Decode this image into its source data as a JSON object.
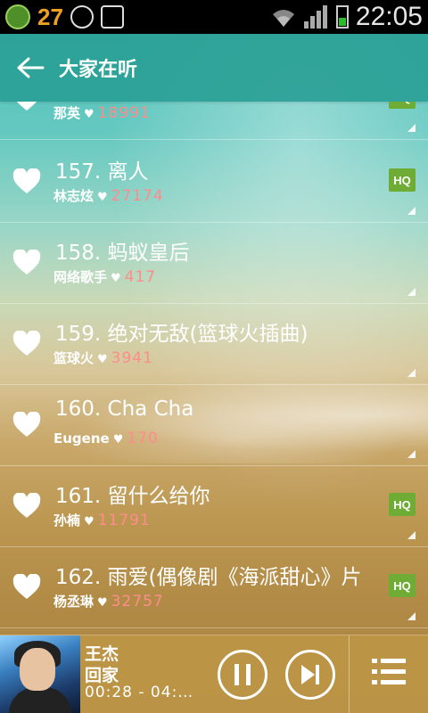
{
  "status_bar": {
    "notification_count": "27",
    "time": "22:05"
  },
  "header": {
    "title": "大家在听"
  },
  "songs": [
    {
      "title": "",
      "artist": "那英",
      "likes": "18991",
      "hq": true
    },
    {
      "title": "157. 离人",
      "artist": "林志炫",
      "likes": "27174",
      "hq": true
    },
    {
      "title": "158. 蚂蚁皇后",
      "artist": "网络歌手",
      "likes": "417",
      "hq": false
    },
    {
      "title": "159. 绝对无敌(篮球火插曲)",
      "artist": "篮球火",
      "likes": "3941",
      "hq": false
    },
    {
      "title": "160. Cha Cha",
      "artist": "Eugene",
      "likes": "170",
      "hq": false
    },
    {
      "title": "161. 留什么给你",
      "artist": "孙楠",
      "likes": "11791",
      "hq": true
    },
    {
      "title": "162. 雨爱(偶像剧《海派甜心》片",
      "artist": "杨丞琳",
      "likes": "32757",
      "hq": true
    }
  ],
  "hq_label": "HQ",
  "player": {
    "artist": "王杰",
    "song": "回家",
    "time": "00:28 - 04:…"
  },
  "colors": {
    "header_bg": "#2aa096",
    "hq_badge": "#6fac35",
    "like_count": "#ff8c8c"
  }
}
